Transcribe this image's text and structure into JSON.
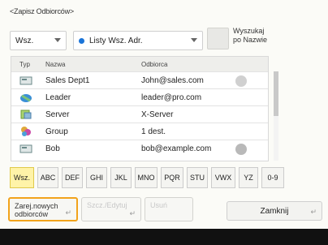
{
  "window": {
    "title": "<Zapisz Odbiorców>"
  },
  "filters": {
    "range_value": "Wsz.",
    "book_value": "Listy Wsz. Adr.",
    "search_by_name_label_line1": "Wyszukaj",
    "search_by_name_label_line2": "po Nazwie"
  },
  "table": {
    "headers": {
      "type": "Typ",
      "name": "Nazwa",
      "recipient": "Odbiorca"
    },
    "rows": [
      {
        "name": "Sales Dept1",
        "recipient": "John@sales.com",
        "icon": "fax-icon",
        "has_action": true
      },
      {
        "name": "Leader",
        "recipient": "leader@pro.com",
        "icon": "email-icon",
        "has_action": false
      },
      {
        "name": "Server",
        "recipient": "X-Server",
        "icon": "server-icon",
        "has_action": false
      },
      {
        "name": "Group",
        "recipient": "1 dest.",
        "icon": "group-icon",
        "has_action": false
      },
      {
        "name": "Bob",
        "recipient": "bob@example.com",
        "icon": "fax-icon",
        "has_action": true
      }
    ]
  },
  "alpha_tabs": [
    "Wsz.",
    "ABC",
    "DEF",
    "GHI",
    "JKL",
    "MNO",
    "PQR",
    "STU",
    "VWX",
    "YZ",
    "0-9"
  ],
  "actions": {
    "register_line1": "Zarej.nowych",
    "register_line2": "odbiorców",
    "details_edit": "Szcz./Edytuj",
    "delete": "Usuń",
    "close": "Zamknij"
  },
  "colors": {
    "highlight": "#f2a31b",
    "selected_tab": "#fff3a8",
    "accent": "#1a74d8"
  }
}
